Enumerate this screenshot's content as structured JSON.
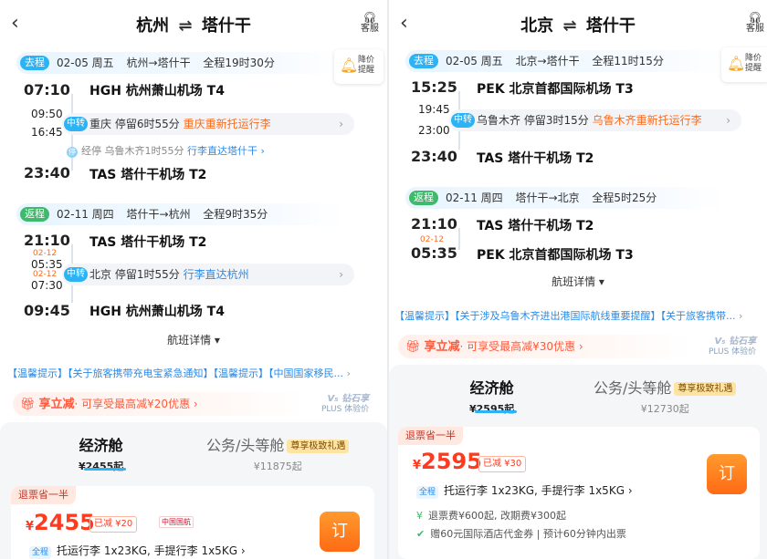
{
  "left": {
    "header": {
      "back_icon": "‹",
      "from": "杭州",
      "to": "塔什干",
      "arrow": "⇌",
      "service_label": "客服"
    },
    "outbound": {
      "tag": "去程",
      "date": "02-05 周五",
      "route": "杭州→塔什干",
      "duration": "全程19时30分",
      "dep_time": "07:10",
      "dep_airport": "HGH 杭州萧山机场 T4",
      "stop_arr": "09:50",
      "stop_dep": "16:45",
      "stop_tag": "中转",
      "stop_city": "重庆",
      "stop_wait": "停留6时55分",
      "stop_note": "重庆重新托运行李",
      "via_text": "经停 乌鲁木齐1时55分",
      "via_link": "行李直达塔什干",
      "arr_time": "23:40",
      "arr_airport": "TAS 塔什干机场 T2"
    },
    "return": {
      "tag": "返程",
      "date": "02-11 周四",
      "route": "塔什干→杭州",
      "duration": "全程9时35分",
      "dep_time": "21:10",
      "dep_airport": "TAS 塔什干机场 T2",
      "stop_arr_date": "02-12",
      "stop_arr": "05:35",
      "stop_dep_date": "02-12",
      "stop_dep": "07:30",
      "stop_tag": "中转",
      "stop_city": "北京",
      "stop_wait": "停留1时55分",
      "stop_note": "行李直达杭州",
      "arr_time": "09:45",
      "arr_airport": "HGH 杭州萧山机场 T4"
    },
    "remind": "降价提醒",
    "detail": "航班详情",
    "notice": "【温馨提示】【关于旅客携带充电宝紧急通知】【温馨提示】【中国国家移民...",
    "promo": {
      "title": "享立减",
      "text": "· 可享受最高减¥20优惠"
    },
    "plus": {
      "top": "V₅ 钻石享",
      "bottom": "PLUS 体验价"
    },
    "cabins": [
      {
        "name": "经济舱",
        "price": "¥2455起"
      },
      {
        "name": "公务/头等舱",
        "badge": "尊享极致礼遇",
        "price": "¥11875起"
      }
    ],
    "card": {
      "half": "退票省一半",
      "cur": "¥",
      "price": "2455",
      "saved": "已减 ¥20",
      "airline": "中国国航",
      "book": "订",
      "quality": "全程",
      "luggage": "托运行李 1x23KG, 手提行李 1x5KG"
    }
  },
  "right": {
    "header": {
      "back_icon": "‹",
      "from": "北京",
      "to": "塔什干",
      "arrow": "⇌",
      "service_label": "客服"
    },
    "outbound": {
      "tag": "去程",
      "date": "02-05 周五",
      "route": "北京→塔什干",
      "duration": "全程11时15分",
      "dep_time": "15:25",
      "dep_airport": "PEK 北京首都国际机场 T3",
      "stop_arr": "19:45",
      "stop_dep": "23:00",
      "stop_tag": "中转",
      "stop_city": "乌鲁木齐",
      "stop_wait": "停留3时15分",
      "stop_note": "乌鲁木齐重新托运行李",
      "arr_time": "23:40",
      "arr_airport": "TAS 塔什干机场 T2"
    },
    "return": {
      "tag": "返程",
      "date": "02-11 周四",
      "route": "塔什干→北京",
      "duration": "全程5时25分",
      "dep_time": "21:10",
      "dep_airport": "TAS 塔什干机场 T2",
      "arr_date": "02-12",
      "arr_time": "05:35",
      "arr_airport": "PEK 北京首都国际机场 T3"
    },
    "remind": "降价提醒",
    "detail": "航班详情",
    "notice": "【温馨提示】【关于涉及乌鲁木齐进出港国际航线重要提醒】【关于旅客携带...",
    "promo": {
      "title": "享立减",
      "text": "· 可享受最高减¥30优惠"
    },
    "plus": {
      "top": "V₅ 钻石享",
      "bottom": "PLUS 体验价"
    },
    "cabins": [
      {
        "name": "经济舱",
        "price": "¥2595起"
      },
      {
        "name": "公务/头等舱",
        "badge": "尊享极致礼遇",
        "price": "¥12730起"
      }
    ],
    "card": {
      "half": "退票省一半",
      "cur": "¥",
      "price": "2595",
      "saved": "已减 ¥30",
      "book": "订",
      "quality": "全程",
      "luggage": "托运行李 1x23KG, 手提行李 1x5KG",
      "refund": "退票费¥600起, 改期费¥300起",
      "hotel": "赠60元国际酒店代金券",
      "ticket_time": "预计60分钟内出票"
    }
  }
}
